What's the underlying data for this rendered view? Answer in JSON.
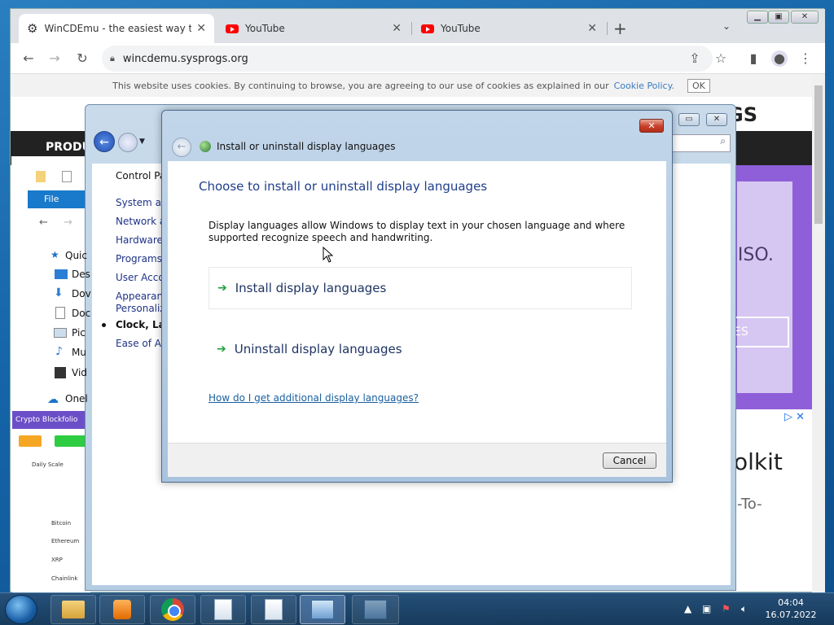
{
  "browser": {
    "tabs": [
      {
        "title": "WinCDEmu - the easiest way to m",
        "active": true
      },
      {
        "title": "YouTube",
        "active": false
      },
      {
        "title": "YouTube",
        "active": false
      }
    ],
    "url": "wincdemu.sysprogs.org",
    "cookie_bar": {
      "text": "This website uses cookies. By continuing to browse, you are agreeing to our use of cookies as explained in our",
      "link": "Cookie Policy.",
      "ok": "OK"
    },
    "site": {
      "logo": "GS",
      "nav": "PRODU",
      "iso": "n ISO.",
      "btn": "ES",
      "olkit": "olkit",
      "to": "-To-",
      "crypto_head": "Crypto Blockfolio",
      "crypto_rows": [
        "Daily Scale",
        "Bitcoin",
        "Ethereum",
        "XRP",
        "Chainlink"
      ]
    }
  },
  "control_panel": {
    "search_icon": "search-icon",
    "links": [
      "Control Pa",
      "System and",
      "Network an",
      "Hardware a",
      "Programs",
      "User Accou",
      "Appearanc",
      "Personaliza",
      "Clock, Lang",
      "Ease of Acc"
    ],
    "explorer": {
      "file": "File",
      "items": [
        "Quic",
        "Des",
        "Dov",
        "Doc",
        "Pic",
        "Mu",
        "Vid",
        "Onel"
      ]
    }
  },
  "dialog": {
    "title": "Install or uninstall display languages",
    "heading": "Choose to install or uninstall display languages",
    "description": "Display languages allow Windows to display text in your chosen language and where supported recognize speech and handwriting.",
    "options": [
      "Install display languages",
      "Uninstall display languages"
    ],
    "help_link": "How do I get additional display languages?",
    "cancel": "Cancel"
  },
  "taskbar": {
    "time": "04:04",
    "date": "16.07.2022"
  }
}
